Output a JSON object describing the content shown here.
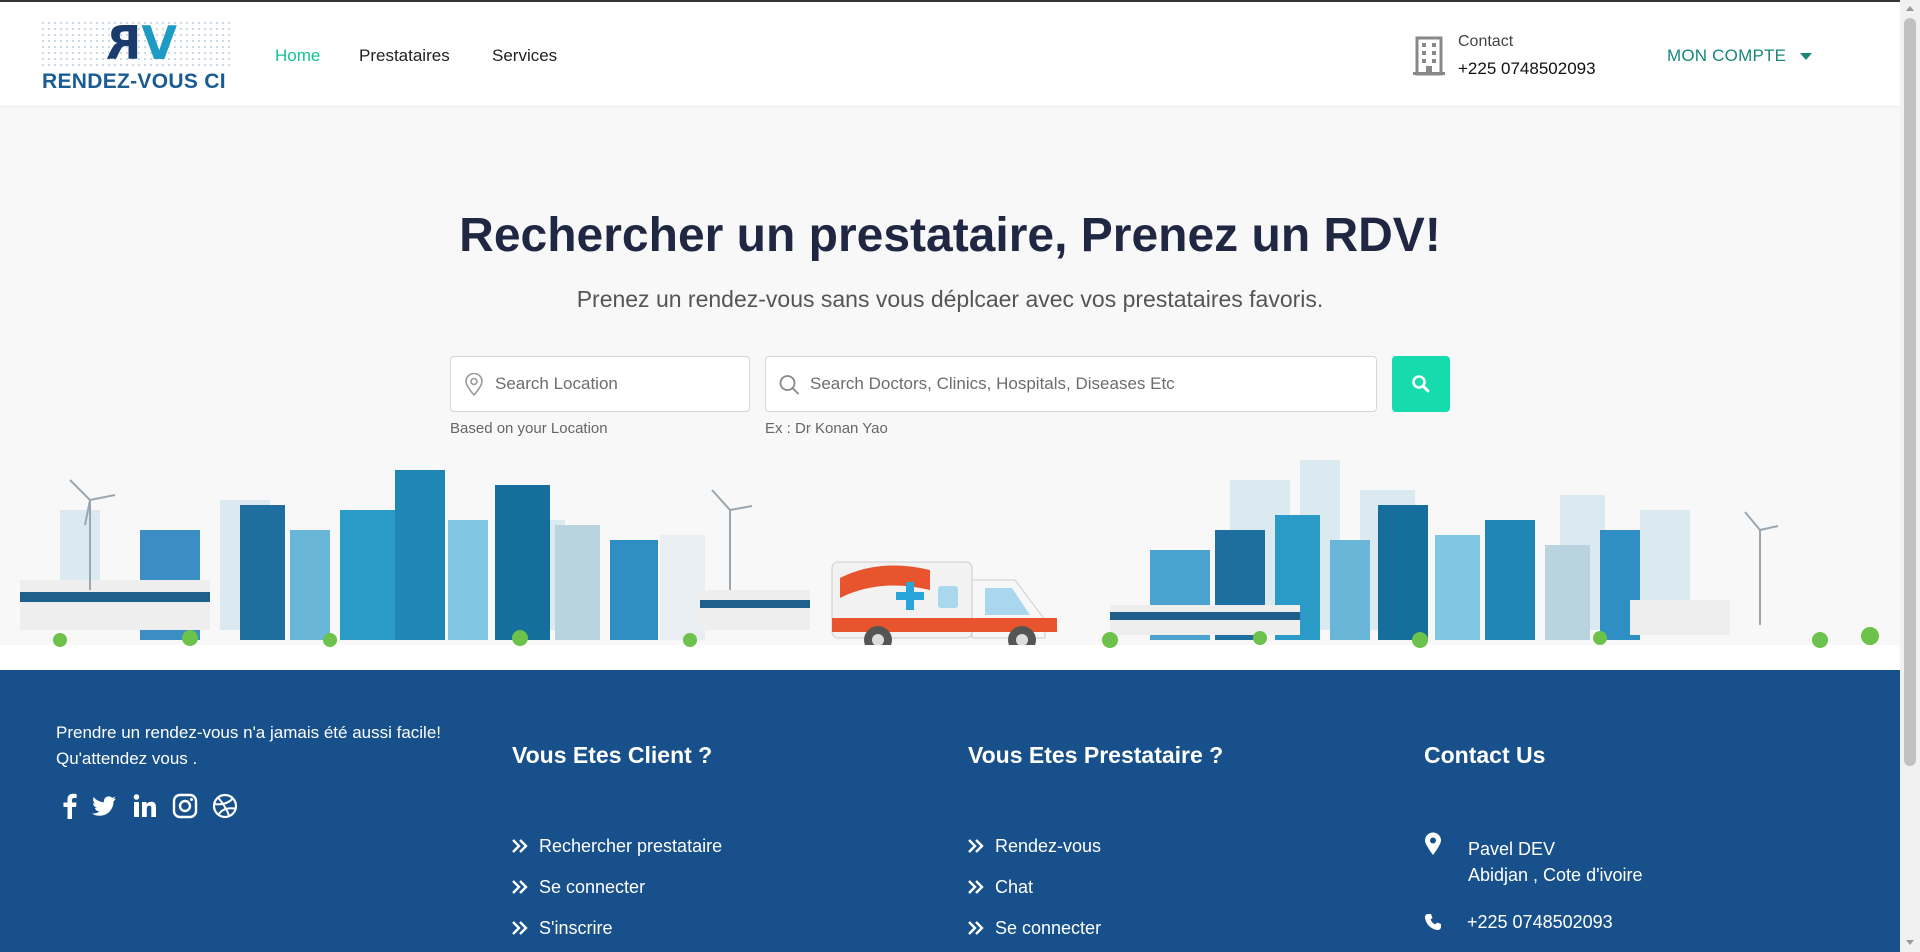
{
  "brand": {
    "logo_text": "RENDEZ-VOUS CI",
    "mark_r": "R",
    "mark_v": "V"
  },
  "nav": {
    "home": "Home",
    "prestataires": "Prestataires",
    "services": "Services"
  },
  "contact": {
    "label": "Contact",
    "phone": "+225 0748502093",
    "icon": "building-icon"
  },
  "account": {
    "label": "MON COMPTE"
  },
  "hero": {
    "title": "Rechercher un prestataire, Prenez un RDV!",
    "subtitle": "Prenez un rendez-vous sans vous déplcaer avec vos prestataires favoris."
  },
  "search": {
    "location_placeholder": "Search Location",
    "location_hint": "Based on your Location",
    "query_placeholder": "Search Doctors, Clinics, Hospitals, Diseases Etc",
    "query_hint": "Ex : Dr Konan Yao"
  },
  "footer": {
    "about_line1": "Prendre un rendez-vous n'a jamais été aussi facile!",
    "about_line2": "Qu'attendez vous .",
    "socials": [
      "facebook-icon",
      "twitter-icon",
      "linkedin-icon",
      "instagram-icon",
      "dribbble-icon"
    ],
    "client": {
      "title": "Vous Etes Client ?",
      "links": [
        "Rechercher prestataire",
        "Se connecter",
        "S'inscrire"
      ]
    },
    "provider": {
      "title": "Vous Etes Prestataire ?",
      "links": [
        "Rendez-vous",
        "Chat",
        "Se connecter"
      ]
    },
    "contact": {
      "title": "Contact Us",
      "name": "Pavel DEV",
      "city": "Abidjan , Cote d'ivoire",
      "phone": "+225 0748502093"
    }
  },
  "colors": {
    "accent": "#13c39c",
    "search_button": "#15dbad",
    "footer_bg": "#17508a",
    "title": "#1f2742"
  }
}
